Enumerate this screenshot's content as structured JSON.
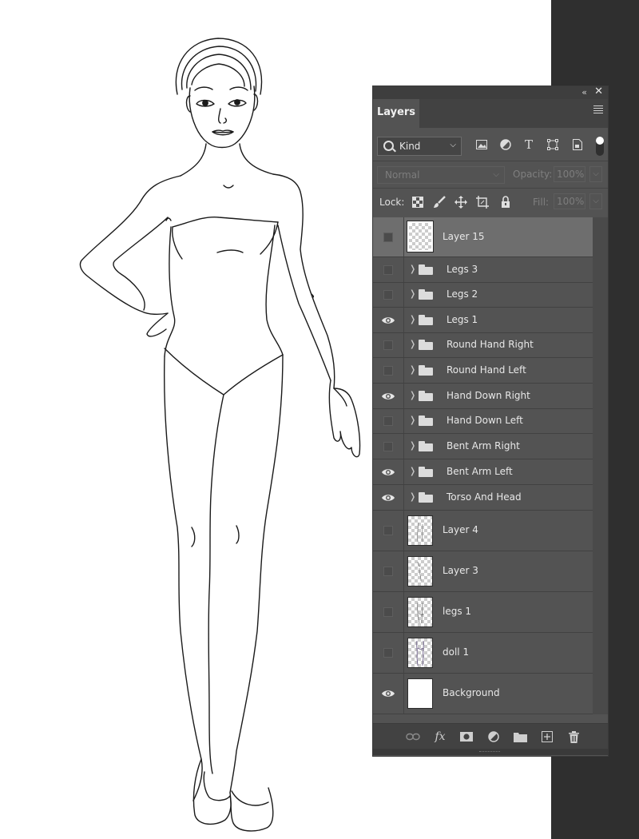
{
  "panel": {
    "tab_label": "Layers",
    "collapse_glyph": "«",
    "close_glyph": "✕"
  },
  "filter": {
    "kind_label": "Kind",
    "icons": [
      "image-filter-icon",
      "adjustment-filter-icon",
      "type-filter-icon",
      "shape-filter-icon",
      "smart-object-filter-icon"
    ]
  },
  "blend": {
    "mode": "Normal",
    "opacity_label": "Opacity:",
    "opacity_value": "100%"
  },
  "lock": {
    "label": "Lock:",
    "fill_label": "Fill:",
    "fill_value": "100%",
    "icons": [
      "lock-transparent-pixels-icon",
      "lock-image-pixels-icon",
      "lock-position-icon",
      "lock-artboard-icon",
      "lock-all-icon"
    ]
  },
  "layers": [
    {
      "name": "Layer 15",
      "type": "layer",
      "visible": false,
      "selected": true
    },
    {
      "name": "Legs 3",
      "type": "group",
      "visible": false
    },
    {
      "name": "Legs 2",
      "type": "group",
      "visible": false
    },
    {
      "name": "Legs 1",
      "type": "group",
      "visible": true
    },
    {
      "name": "Round Hand Right",
      "type": "group",
      "visible": false
    },
    {
      "name": "Round Hand Left",
      "type": "group",
      "visible": false
    },
    {
      "name": "Hand Down Right",
      "type": "group",
      "visible": true
    },
    {
      "name": "Hand Down Left",
      "type": "group",
      "visible": false
    },
    {
      "name": "Bent Arm Right",
      "type": "group",
      "visible": false
    },
    {
      "name": "Bent Arm Left",
      "type": "group",
      "visible": true
    },
    {
      "name": "Torso And Head",
      "type": "group",
      "visible": true
    },
    {
      "name": "Layer 4",
      "type": "layer",
      "visible": false
    },
    {
      "name": "Layer 3",
      "type": "layer",
      "visible": false
    },
    {
      "name": "legs 1",
      "type": "layer",
      "visible": false
    },
    {
      "name": "doll 1",
      "type": "layer",
      "visible": false
    },
    {
      "name": "Background",
      "type": "background",
      "visible": true
    }
  ],
  "bottom_toolbar": [
    "link-layers-icon",
    "fx-icon",
    "add-mask-icon",
    "new-adjustment-icon",
    "new-group-icon",
    "new-layer-icon",
    "delete-layer-icon"
  ],
  "bottom_fx_label": "fx"
}
